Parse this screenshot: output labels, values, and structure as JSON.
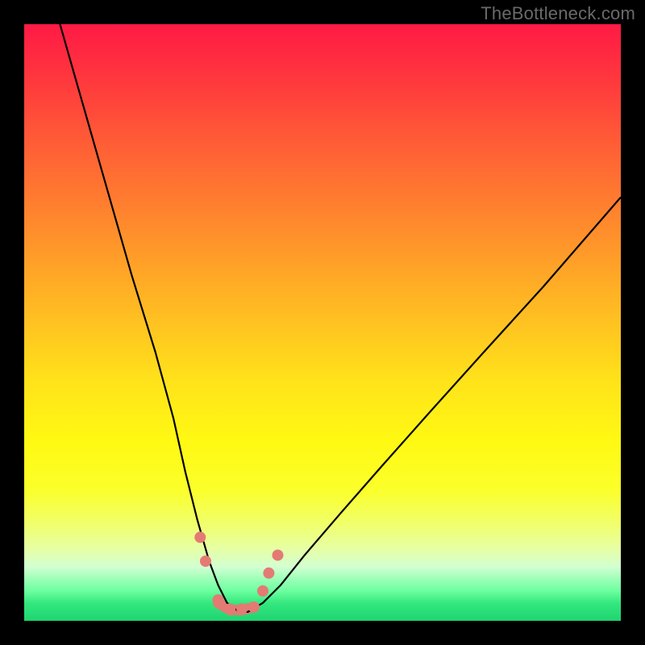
{
  "watermark": {
    "text": "TheBottleneck.com"
  },
  "chart_data": {
    "type": "line",
    "title": "",
    "xlabel": "",
    "ylabel": "",
    "xlim": [
      0,
      100
    ],
    "ylim": [
      0,
      100
    ],
    "grid": false,
    "background_gradient": {
      "direction": "vertical",
      "stops": [
        {
          "pos": 0.0,
          "color": "#ff1a45"
        },
        {
          "pos": 0.2,
          "color": "#ff5d36"
        },
        {
          "pos": 0.4,
          "color": "#ffa028"
        },
        {
          "pos": 0.6,
          "color": "#ffe31a"
        },
        {
          "pos": 0.8,
          "color": "#f5ff5a"
        },
        {
          "pos": 1.0,
          "color": "#1fd470"
        }
      ]
    },
    "series": [
      {
        "name": "bottleneck-curve",
        "color": "#000000",
        "width": 2.2,
        "x": [
          6,
          10,
          14,
          18,
          22,
          25,
          27,
          29,
          31,
          32.5,
          34,
          36,
          37.5,
          40,
          43,
          47,
          53,
          60,
          68,
          77,
          87,
          100
        ],
        "y": [
          100,
          86,
          72,
          58,
          45,
          34,
          25,
          17,
          10,
          6,
          3,
          1.5,
          1.5,
          3,
          6,
          11,
          18,
          26,
          35,
          45,
          56,
          71
        ]
      }
    ],
    "markers": {
      "name": "highlight-dots",
      "color": "#e47a74",
      "radius": 7,
      "points": [
        {
          "x": 29.5,
          "y": 14
        },
        {
          "x": 30.4,
          "y": 10
        },
        {
          "x": 32.5,
          "y": 3.5
        },
        {
          "x": 34.5,
          "y": 2
        },
        {
          "x": 36.5,
          "y": 2
        },
        {
          "x": 38.5,
          "y": 2.3
        },
        {
          "x": 40,
          "y": 5
        },
        {
          "x": 41,
          "y": 8
        },
        {
          "x": 42.5,
          "y": 11
        }
      ],
      "connector": {
        "color": "#e47a74",
        "width": 13,
        "x": [
          32.5,
          34.5,
          36.5,
          38.5
        ],
        "y": [
          3.0,
          1.8,
          1.8,
          2.3
        ]
      }
    }
  }
}
